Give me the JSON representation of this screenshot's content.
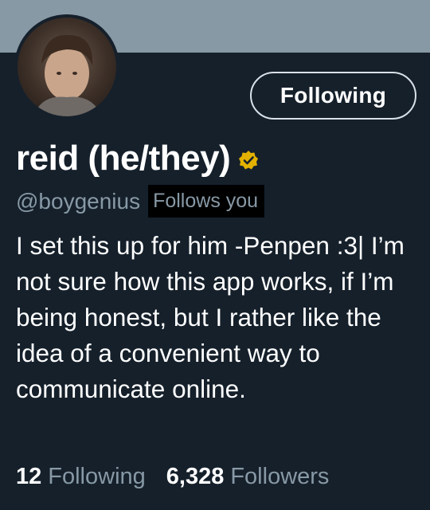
{
  "profile": {
    "display_name": "reid (he/they)",
    "handle": "@boygenius",
    "follows_you_badge": "Follows you",
    "bio": "I set this up for him -Penpen :3| I’m not sure how this app works, if I’m being honest, but I rather like the idea of a convenient way to communicate online.",
    "verified_icon": "verified-badge-icon"
  },
  "actions": {
    "follow_button_label": "Following"
  },
  "stats": {
    "following_count": "12",
    "following_label": "Following",
    "followers_count": "6,328",
    "followers_label": "Followers"
  },
  "colors": {
    "background": "#15202b",
    "banner": "#8899a6",
    "secondary_text": "#8899a6",
    "verified_badge": "#e3b100"
  }
}
